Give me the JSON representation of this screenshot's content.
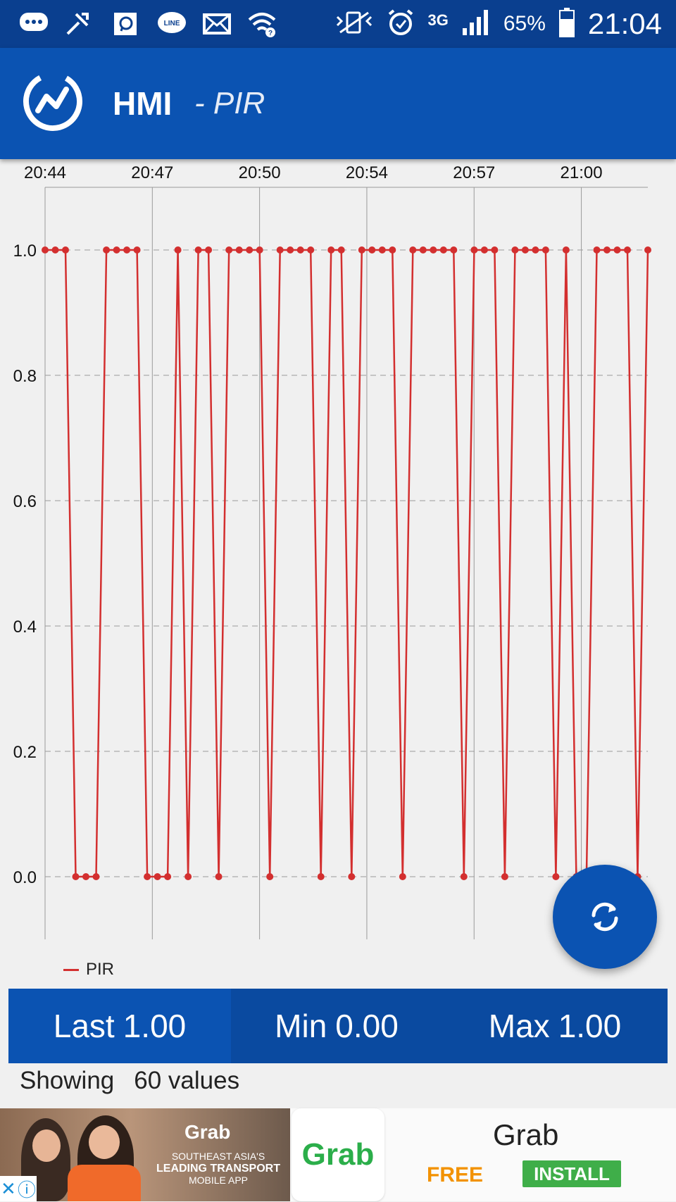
{
  "status_bar": {
    "battery": "65%",
    "network": "3G",
    "time": "21:04",
    "icons_left": [
      "messages-icon",
      "app-icon",
      "chat-icon",
      "line-icon",
      "mail-icon",
      "wifi-question-icon"
    ],
    "icons_right": [
      "vibrate-mute-icon",
      "alarm-icon",
      "network-3g-icon",
      "signal-icon",
      "battery-icon"
    ]
  },
  "app_bar": {
    "title": "HMI",
    "subtitle": "- PIR",
    "logo_icon": "trend-logo-icon"
  },
  "chart_data": {
    "type": "line",
    "x_tick_labels": [
      "20:44",
      "20:47",
      "20:50",
      "20:54",
      "20:57",
      "21:00"
    ],
    "y_tick_labels": [
      "1.0",
      "0.8",
      "0.6",
      "0.4",
      "0.2",
      "0.0"
    ],
    "ylim": [
      -0.1,
      1.1
    ],
    "y_ticks": [
      1.0,
      0.8,
      0.6,
      0.4,
      0.2,
      0.0
    ],
    "grid": true,
    "legend_position": "bottom-left",
    "series": [
      {
        "name": "PIR",
        "color": "#d32f2f",
        "values": [
          1,
          1,
          1,
          0,
          0,
          0,
          1,
          1,
          1,
          1,
          0,
          0,
          0,
          1,
          0,
          1,
          1,
          0,
          1,
          1,
          1,
          1,
          0,
          1,
          1,
          1,
          1,
          0,
          1,
          1,
          0,
          1,
          1,
          1,
          1,
          0,
          1,
          1,
          1,
          1,
          1,
          0,
          1,
          1,
          1,
          0,
          1,
          1,
          1,
          1,
          0,
          1,
          0,
          0,
          1,
          1,
          1,
          1,
          0,
          1
        ]
      }
    ]
  },
  "legend": {
    "label": "PIR",
    "color": "#d32f2f"
  },
  "fab": {
    "icon": "refresh-icon"
  },
  "stats": {
    "last_label": "Last",
    "last_value": "1.00",
    "min_label": "Min",
    "min_value": "0.00",
    "max_label": "Max",
    "max_value": "1.00"
  },
  "showing": {
    "label": "Showing",
    "value": "60 values"
  },
  "ad": {
    "banner_logo": "Grab",
    "banner_line1": "SOUTHEAST ASIA'S",
    "banner_line2": "LEADING TRANSPORT",
    "banner_line3": "MOBILE APP",
    "app_icon_text": "Grab",
    "app_name": "Grab",
    "price": "FREE",
    "install_label": "INSTALL"
  },
  "colors": {
    "status_bar": "#0a3f8f",
    "app_bar": "#0b53b2",
    "series": "#d32f2f",
    "install": "#3fae49",
    "free": "#f29200"
  }
}
